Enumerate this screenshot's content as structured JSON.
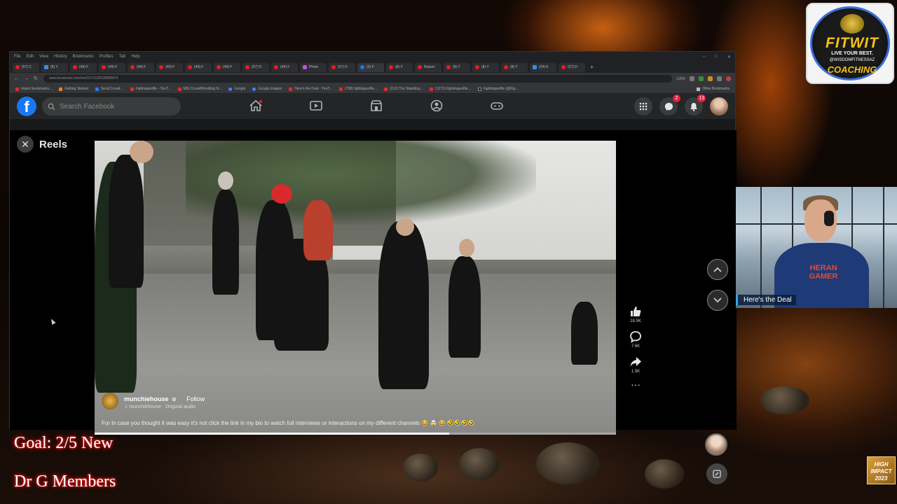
{
  "browser": {
    "menu": [
      "File",
      "Edit",
      "View",
      "History",
      "Bookmarks",
      "Profiles",
      "Tab",
      "Help"
    ],
    "tabs": [
      "(57) C",
      "(8) Y",
      "(49) F",
      "(49) F",
      "(49) F",
      "(49) F",
      "(49) F",
      "(49) F",
      "(57) D",
      "(49) F",
      "Photo",
      "(57) D",
      "(2) F",
      "(8) Y",
      "Report",
      "(8) Y",
      "(8) Y",
      "(8) Y",
      "(24) K",
      "(57) D"
    ],
    "active_tab_index": 12,
    "address": "www.facebook.com/reel/1071528138889874",
    "zoom": "125%",
    "bookmarks": [
      "Import bookmarks...",
      "Getting Started",
      "Send Crowd...",
      "Fightingwolfie - YouT...",
      "MIS CrowdWrestling N...",
      "Google",
      "Google Images",
      "Here's the Deal - YouT...",
      "(798) fightingwolfie...",
      "(213) The Standing...",
      "(1272) Fightingwolfie...",
      "Fightingwolfie (@Fig..."
    ],
    "bookmarks_other": "Other Bookmarks"
  },
  "facebook": {
    "logo_letter": "f",
    "search_placeholder": "Search Facebook",
    "badges": {
      "messenger": "2",
      "notifications": "13"
    }
  },
  "reels": {
    "title": "Reels",
    "creator": "munchiehouse",
    "follow": "Follow",
    "audio": "munchiehouse · Original audio",
    "caption": "For in case you thought it was easy it's not click the link in my bio to watch full interviews or interactions on my different channels 😂 🤯 😂 🤣🤣🤣🤣",
    "likes": "18.5K",
    "comments": "7.6K",
    "shares": "1.5K",
    "progress_fraction": 0.68
  },
  "webcam": {
    "shirt_line1": "HERAN",
    "shirt_line2": "GAMER",
    "label": "Here's the Deal"
  },
  "logo": {
    "title": "FITWIT",
    "tagline": "LIVE YOUR BEST.",
    "handle": "@WISDOMFITNESSAZ",
    "coaching": "COACHING"
  },
  "overlay": {
    "goal_line1": "Goal: 2/5 New",
    "goal_line2": "Dr G Members"
  },
  "badge": {
    "line1": "HIGH",
    "line2": "IMPACT",
    "line3": "2023"
  },
  "colors": {
    "fb_blue": "#1877f2",
    "goal_glow": "#e01818",
    "logo_gold": "#f2c21b"
  }
}
